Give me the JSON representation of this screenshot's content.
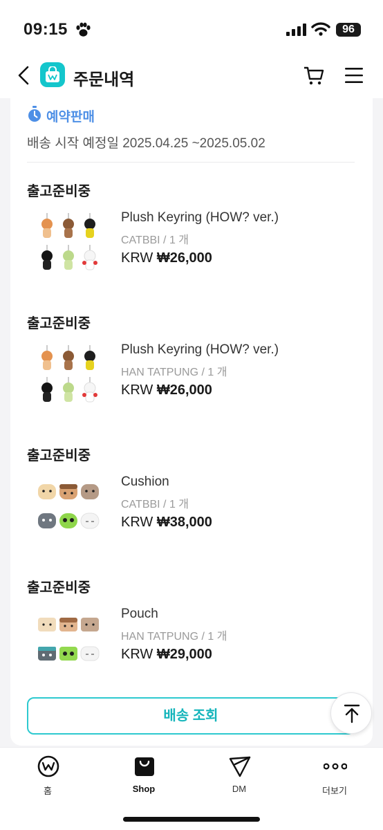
{
  "status_bar": {
    "time": "09:15",
    "battery": "96"
  },
  "nav": {
    "title": "주문내역"
  },
  "preorder": {
    "label": "예약판매",
    "ship_date": "배송 시작 예정일 2025.04.25 ~2025.05.02"
  },
  "orders": [
    {
      "status": "출고준비중",
      "name": "Plush Keyring (HOW? ver.)",
      "seller_qty": "CATBBI / 1 개",
      "currency": "KRW",
      "price": "₩26,000"
    },
    {
      "status": "출고준비중",
      "name": "Plush Keyring (HOW? ver.)",
      "seller_qty": "HAN TATPUNG / 1 개",
      "currency": "KRW",
      "price": "₩26,000"
    },
    {
      "status": "출고준비중",
      "name": "Cushion",
      "seller_qty": "CATBBI / 1 개",
      "currency": "KRW",
      "price": "₩38,000"
    },
    {
      "status": "출고준비중",
      "name": "Pouch",
      "seller_qty": "HAN TATPUNG / 1 개",
      "currency": "KRW",
      "price": "₩29,000"
    }
  ],
  "track_button": "배송 조회",
  "tabs": [
    {
      "label": "홈",
      "icon": "weverse-home-icon"
    },
    {
      "label": "Shop",
      "icon": "shop-bag-icon",
      "active": true
    },
    {
      "label": "DM",
      "icon": "dm-send-icon"
    },
    {
      "label": "더보기",
      "icon": "more-dots-icon"
    }
  ],
  "colors": {
    "accent": "#14c6cc",
    "preorder": "#4d8fe6",
    "track_border": "#2cc9cf"
  }
}
